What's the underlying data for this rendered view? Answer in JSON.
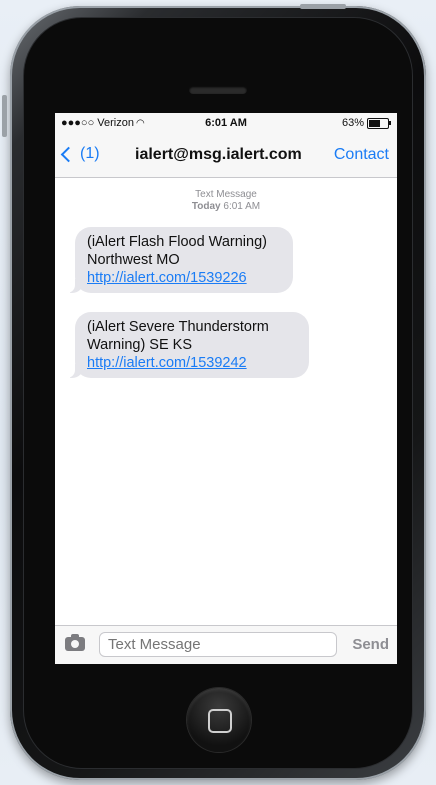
{
  "status_bar": {
    "carrier": "●●●○○ Verizon",
    "time": "6:01 AM",
    "battery": "63%",
    "battery_level": 0.63
  },
  "nav": {
    "back_label": "(1)",
    "title": "ialert@msg.ialert.com",
    "contact_label": "Contact"
  },
  "thread": {
    "type_label": "Text Message",
    "day_label": "Today",
    "time_label": "6:01 AM"
  },
  "messages": [
    {
      "text": "(iAlert Flash Flood Warning) Northwest MO ",
      "link": "http://ialert.com/1539226"
    },
    {
      "text": "(iAlert Severe Thunderstorm Warning) SE KS ",
      "link": "http://ialert.com/1539242"
    }
  ],
  "input": {
    "placeholder": "Text Message",
    "send_label": "Send"
  },
  "icons": {
    "back": "chevron-left-icon",
    "camera": "camera-icon",
    "wifi": "wifi-icon",
    "battery": "battery-icon",
    "home": "home-button-icon"
  },
  "colors": {
    "accent": "#1a7cf5",
    "bubble": "#e5e5ea"
  }
}
